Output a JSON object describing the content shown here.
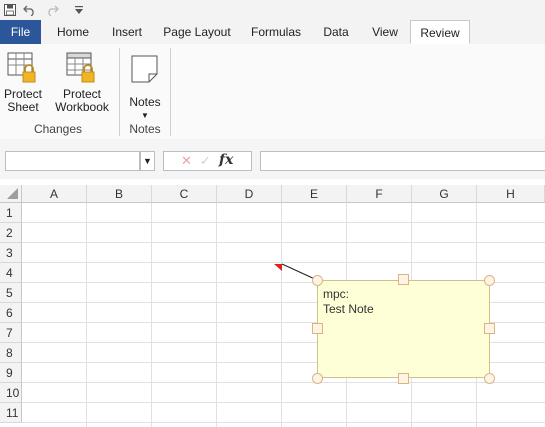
{
  "quick_access": {
    "save_icon": "save-icon",
    "undo_icon": "undo-icon",
    "redo_icon": "redo-icon",
    "customize_icon": "customize-arrow-icon"
  },
  "tabs": [
    {
      "label": "File"
    },
    {
      "label": "Home"
    },
    {
      "label": "Insert"
    },
    {
      "label": "Page Layout"
    },
    {
      "label": "Formulas"
    },
    {
      "label": "Data"
    },
    {
      "label": "View"
    },
    {
      "label": "Review"
    }
  ],
  "active_tab": "Review",
  "ribbon": {
    "protect_sheet": {
      "line1": "Protect",
      "line2": "Sheet"
    },
    "protect_workbook": {
      "line1": "Protect",
      "line2": "Workbook"
    },
    "notes_button": {
      "label": "Notes",
      "arrow": "▼"
    },
    "groups": {
      "changes": "Changes",
      "notes": "Notes"
    }
  },
  "formula_bar": {
    "name_box": "",
    "dropdown_arrow": "▼",
    "cancel": "✕",
    "enter": "✓",
    "fx": "fx",
    "formula": ""
  },
  "columns": [
    "A",
    "B",
    "C",
    "D",
    "E",
    "F",
    "G",
    "H"
  ],
  "rows": [
    "1",
    "2",
    "3",
    "4",
    "5",
    "6",
    "7",
    "8",
    "9",
    "10",
    "11"
  ],
  "note": {
    "author": "mpc:",
    "text": "Test Note",
    "cell": "D4"
  },
  "colors": {
    "file_tab": "#2b579a",
    "note_fill": "#ffffd7",
    "note_indicator": "#e02020",
    "lock": "#f0b429"
  }
}
